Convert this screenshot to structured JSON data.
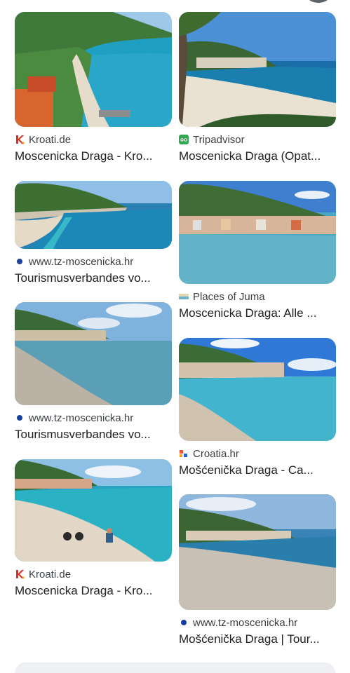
{
  "results": {
    "left": [
      {
        "source": "Kroati.de",
        "title": "Moscenicka Draga - Kro...",
        "icon": "kroati-logo-icon",
        "accent": "#d93025"
      },
      {
        "source": "www.tz-moscenicka.hr",
        "title": "Tourismusverbandes vo...",
        "icon": "blue-dot-icon",
        "accent": "#1a3fa0"
      },
      {
        "source": "www.tz-moscenicka.hr",
        "title": "Tourismusverbandes vo...",
        "icon": "blue-dot-icon",
        "accent": "#1a3fa0"
      },
      {
        "source": "Kroati.de",
        "title": "Moscenicka Draga - Kro...",
        "icon": "kroati-logo-icon",
        "accent": "#d93025"
      }
    ],
    "right": [
      {
        "source": "Tripadvisor",
        "title": "Moscenicka Draga (Opat...",
        "icon": "tripadvisor-logo-icon",
        "accent": "#34a853"
      },
      {
        "source": "Places of Juma",
        "title": "Moscenicka Draga: Alle ...",
        "icon": "places-of-juma-logo-icon",
        "accent": "#6cb4c9"
      },
      {
        "source": "Croatia.hr",
        "title": "Mošćenička Draga - Ca...",
        "icon": "croatia-logo-icon",
        "accent": "#e8542f"
      },
      {
        "source": "www.tz-moscenicka.hr",
        "title": "Mošćenička Draga | Tour...",
        "icon": "blue-dot-icon",
        "accent": "#1a3fa0"
      }
    ]
  }
}
